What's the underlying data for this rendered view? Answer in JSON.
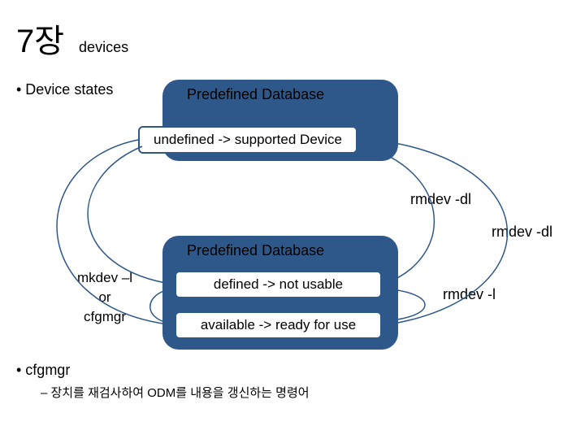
{
  "chart_data": {
    "type": "diagram",
    "title": "7장 devices",
    "nodes": [
      {
        "id": "predefined_db_1",
        "label": "Predefined Database",
        "kind": "database"
      },
      {
        "id": "undefined_supported",
        "label": "undefined -> supported Device",
        "kind": "state"
      },
      {
        "id": "predefined_db_2",
        "label": "Predefined Database",
        "kind": "database"
      },
      {
        "id": "defined_not_usable",
        "label": "defined -> not usable",
        "kind": "state"
      },
      {
        "id": "available_ready",
        "label": "available -> ready for use",
        "kind": "state"
      }
    ],
    "edges": [
      {
        "from": "undefined_supported",
        "to": "defined_not_usable",
        "label": "mkdev -l or cfgmgr",
        "side": "left"
      },
      {
        "from": "defined_not_usable",
        "to": "available_ready",
        "label": "mkdev -l or cfgmgr",
        "side": "left"
      },
      {
        "from": "defined_not_usable",
        "to": "undefined_supported",
        "label": "rmdev -dl",
        "side": "right"
      },
      {
        "from": "available_ready",
        "to": "undefined_supported",
        "label": "rmdev -dl",
        "side": "right"
      },
      {
        "from": "available_ready",
        "to": "defined_not_usable",
        "label": "rmdev -l",
        "side": "right"
      }
    ],
    "annotations": [
      "cfgmgr: 장치를 재검사하여 ODM를 내용을 갱신하는 명령어"
    ]
  },
  "title": {
    "big": "7장",
    "sub": "devices"
  },
  "bullets": {
    "device_states": "• Device states",
    "cfgmgr": "• cfgmgr",
    "cfgmgr_desc": "– 장치를 재검사하여 ODM를 내용을 갱신하는 명령어"
  },
  "db": {
    "label1": "Predefined  Database",
    "label2": "Predefined  Database"
  },
  "boxes": {
    "undefined": "undefined -> supported Device",
    "defined": "defined -> not usable",
    "available": "available -> ready for use"
  },
  "labels": {
    "rmdev_dl1": "rmdev -dl",
    "rmdev_dl2": "rmdev -dl",
    "rmdev_l": "rmdev -l",
    "mkdev": "mkdev –l\nor\ncfgmgr"
  }
}
